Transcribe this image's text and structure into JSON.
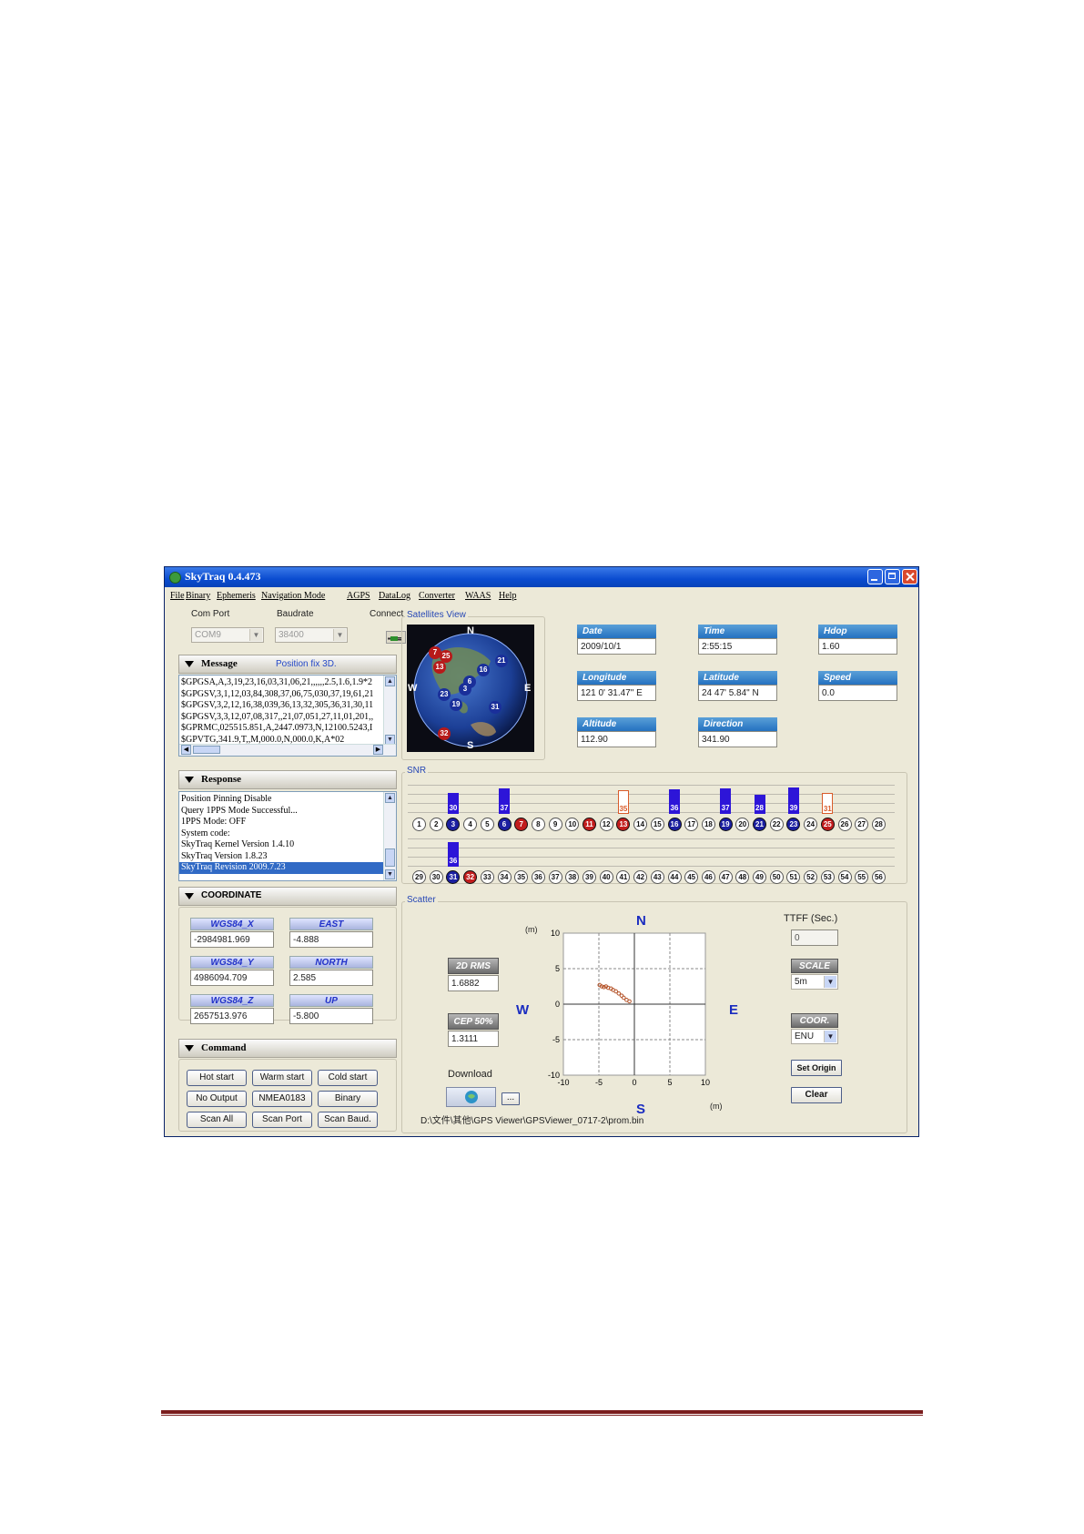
{
  "app": {
    "title": "SkyTraq 0.4.473"
  },
  "menu": [
    "File",
    "Binary",
    "Ephemeris",
    "Navigation Mode",
    "AGPS",
    "DataLog",
    "Converter",
    "WAAS",
    "Help"
  ],
  "connection": {
    "com_port_label": "Com Port",
    "com_port_value": "COM9",
    "baudrate_label": "Baudrate",
    "baudrate_value": "38400",
    "connect_label": "Connect"
  },
  "message": {
    "title": "Message",
    "status": "Position fix 3D.",
    "lines": [
      "$GPGSA,A,3,19,23,16,03,31,06,21,,,,,,2.5,1.6,1.9*2",
      "$GPGSV,3,1,12,03,84,308,37,06,75,030,37,19,61,21",
      "$GPGSV,3,2,12,16,38,039,36,13,32,305,36,31,30,11",
      "$GPGSV,3,3,12,07,08,317,,21,07,051,27,11,01,201,,",
      "$GPRMC,025515.851,A,2447.0973,N,12100.5243,I",
      "$GPVTG,341.9,T,,M,000.0,N,000.0,K,A*02"
    ]
  },
  "response": {
    "title": "Response",
    "lines": [
      "Position Pinning Disable",
      "Query 1PPS Mode Successful...",
      "1PPS Mode: OFF",
      "System code:",
      "SkyTraq Kernel Version 1.4.10",
      "SkyTraq Version 1.8.23",
      "SkyTraq Revision 2009.7.23"
    ]
  },
  "coordinate": {
    "title": "COORDINATE",
    "wgs84_x_label": "WGS84_X",
    "wgs84_x": "-2984981.969",
    "east_label": "EAST",
    "east": "-4.888",
    "wgs84_y_label": "WGS84_Y",
    "wgs84_y": "4986094.709",
    "north_label": "NORTH",
    "north": "2.585",
    "wgs84_z_label": "WGS84_Z",
    "wgs84_z": "2657513.976",
    "up_label": "UP",
    "up": "-5.800"
  },
  "command": {
    "title": "Command",
    "buttons": [
      "Hot start",
      "Warm start",
      "Cold start",
      "No Output",
      "NMEA0183",
      "Binary",
      "Scan All",
      "Scan Port",
      "Scan Baud."
    ]
  },
  "satview": {
    "label": "Satellites View",
    "compass": {
      "n": "N",
      "s": "S",
      "e": "E",
      "w": "W"
    },
    "sats": [
      {
        "id": "7",
        "color": "red"
      },
      {
        "id": "25",
        "color": "red"
      },
      {
        "id": "13",
        "color": "red"
      },
      {
        "id": "16",
        "color": "blue"
      },
      {
        "id": "21",
        "color": "blue"
      },
      {
        "id": "6",
        "color": "blue"
      },
      {
        "id": "3",
        "color": "blue"
      },
      {
        "id": "23",
        "color": "blue"
      },
      {
        "id": "19",
        "color": "blue"
      },
      {
        "id": "31",
        "color": "blue"
      },
      {
        "id": "32",
        "color": "red"
      }
    ]
  },
  "info": {
    "date_label": "Date",
    "date": "2009/10/1",
    "time_label": "Time",
    "time": "2:55:15",
    "hdop_label": "Hdop",
    "hdop": "1.60",
    "longitude_label": "Longitude",
    "longitude": "121 0' 31.47\" E",
    "latitude_label": "Latitude",
    "latitude": "24 47' 5.84\" N",
    "speed_label": "Speed",
    "speed": "0.0",
    "altitude_label": "Altitude",
    "altitude": "112.90",
    "direction_label": "Direction",
    "direction": "341.90"
  },
  "snr": {
    "label": "SNR",
    "row1_bars": [
      {
        "label": "30",
        "slot": 3,
        "value": 30,
        "type": "blue"
      },
      {
        "label": "37",
        "slot": 6,
        "value": 37,
        "type": "blue"
      },
      {
        "label": "35",
        "slot": 13,
        "value": 35,
        "type": "outline"
      },
      {
        "label": "36",
        "slot": 16,
        "value": 36,
        "type": "blue"
      },
      {
        "label": "37",
        "slot": 19,
        "value": 37,
        "type": "blue"
      },
      {
        "label": "28",
        "slot": 21,
        "value": 28,
        "type": "blue"
      },
      {
        "label": "39",
        "slot": 23,
        "value": 39,
        "type": "blue"
      },
      {
        "label": "31",
        "slot": 25,
        "value": 31,
        "type": "outline"
      }
    ],
    "row2_bars": [
      {
        "label": "36",
        "slot": 3,
        "value": 36,
        "type": "blue"
      }
    ],
    "row1_sats": [
      "1",
      "2",
      "3",
      "4",
      "5",
      "6",
      "7",
      "8",
      "9",
      "10",
      "11",
      "12",
      "13",
      "14",
      "15",
      "16",
      "17",
      "18",
      "19",
      "20",
      "21",
      "22",
      "23",
      "24",
      "25",
      "26",
      "27",
      "28"
    ],
    "row1_colors": [
      "n",
      "n",
      "b",
      "n",
      "n",
      "b",
      "r",
      "n",
      "n",
      "n",
      "r",
      "n",
      "r",
      "n",
      "n",
      "b",
      "n",
      "n",
      "b",
      "n",
      "b",
      "n",
      "b",
      "n",
      "r",
      "n",
      "n",
      "n"
    ],
    "row2_sats": [
      "29",
      "30",
      "31",
      "32",
      "33",
      "34",
      "35",
      "36",
      "37",
      "38",
      "39",
      "40",
      "41",
      "42",
      "43",
      "44",
      "45",
      "46",
      "47",
      "48",
      "49",
      "50",
      "51",
      "52",
      "53",
      "54",
      "55",
      "56"
    ],
    "row2_colors": [
      "n",
      "n",
      "b",
      "r",
      "n",
      "n",
      "n",
      "n",
      "n",
      "n",
      "n",
      "n",
      "n",
      "n",
      "n",
      "n",
      "n",
      "n",
      "n",
      "n",
      "n",
      "n",
      "n",
      "n",
      "n",
      "n",
      "n",
      "n"
    ]
  },
  "scatter": {
    "label": "Scatter",
    "rms_label": "2D RMS",
    "rms": "1.6882",
    "cep_label": "CEP 50%",
    "cep": "1.3111",
    "download_label": "Download",
    "browse_label": "...",
    "file_path": "D:\\文件\\其他\\GPS Viewer\\GPSViewer_0717-2\\prom.bin",
    "compass": {
      "n": "N",
      "s": "S",
      "e": "E",
      "w": "W"
    },
    "unit_y": "(m)",
    "unit_x": "(m)",
    "y_ticks": [
      "10",
      "5",
      "0",
      "-5",
      "-10"
    ],
    "x_ticks": [
      "-10",
      "-5",
      "0",
      "5",
      "10"
    ],
    "ttff_label": "TTFF (Sec.)",
    "ttff": "0",
    "scale_label": "SCALE",
    "scale": "5m",
    "coor_label": "COOR.",
    "coor": "ENU",
    "set_origin": "Set Origin",
    "clear": "Clear"
  },
  "chart_data": {
    "type": "scatter",
    "xlabel": "(m)",
    "ylabel": "(m)",
    "xlim": [
      -10,
      10
    ],
    "ylim": [
      -10,
      10
    ],
    "x_ticks": [
      -10,
      -5,
      0,
      5,
      10
    ],
    "y_ticks": [
      -10,
      -5,
      0,
      5,
      10
    ],
    "points": [
      {
        "x": -4.9,
        "y": 2.7
      },
      {
        "x": -4.6,
        "y": 2.5
      },
      {
        "x": -4.3,
        "y": 2.4
      },
      {
        "x": -4.0,
        "y": 2.5
      },
      {
        "x": -3.7,
        "y": 2.3
      },
      {
        "x": -3.3,
        "y": 2.2
      },
      {
        "x": -3.0,
        "y": 2.0
      },
      {
        "x": -2.6,
        "y": 1.8
      },
      {
        "x": -2.2,
        "y": 1.5
      },
      {
        "x": -1.8,
        "y": 1.2
      },
      {
        "x": -1.5,
        "y": 0.9
      },
      {
        "x": -1.1,
        "y": 0.6
      },
      {
        "x": -0.7,
        "y": 0.4
      }
    ]
  }
}
